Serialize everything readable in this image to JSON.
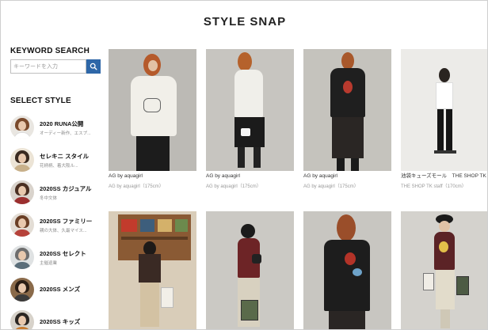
{
  "header": {
    "title": "STYLE SNAP"
  },
  "sidebar": {
    "keyword_title": "KEYWORD SEARCH",
    "search_placeholder": "キーワードを入力",
    "search_icon": "search-icon",
    "select_title": "SELECT STYLE",
    "styles": [
      {
        "name": "2020 RUNA公開",
        "desc": "オーディー新作、エスプ..."
      },
      {
        "name": "セレキニ スタイル",
        "desc": "花柄柄、着大阪ル..."
      },
      {
        "name": "2020SS カジュアル",
        "desc": "冬中文体"
      },
      {
        "name": "2020SS ファミリー",
        "desc": "親の大体、久最マイス..."
      },
      {
        "name": "2020SS セレクト",
        "desc": "主催巡業"
      },
      {
        "name": "2020SS メンズ",
        "desc": ""
      },
      {
        "name": "2020SS キッズ",
        "desc": ""
      }
    ]
  },
  "snaps": [
    {
      "brand": "AG by aquagirl",
      "model": "AG by aquagirl（175cm）"
    },
    {
      "brand": "AG by aquagirl",
      "model": "AG by aquagirl（175cm）"
    },
    {
      "brand": "AG by aquagirl",
      "model": "AG by aquagirl（175cm）"
    },
    {
      "brand": "池袋キューズモール　THE SHOP TK",
      "model": "THE SHOP TK staff（170cm）"
    },
    {
      "brand": "",
      "model": ""
    },
    {
      "brand": "",
      "model": ""
    },
    {
      "brand": "",
      "model": ""
    },
    {
      "brand": "",
      "model": ""
    }
  ],
  "colors": {
    "accent": "#2e67a8",
    "title": "#222222"
  }
}
